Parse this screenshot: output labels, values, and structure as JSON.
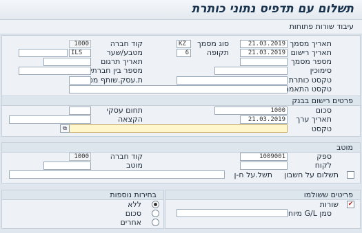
{
  "title": "תשלום עם תדפיס נתוני כותרת",
  "toolbar": {
    "open_items_label": "עיבוד שורות פתוחות"
  },
  "header_fields": {
    "doc_date": {
      "label": "תאריך מסמך",
      "value": "21.03.2019"
    },
    "doc_type": {
      "label": "סוג מסמך",
      "value": "KZ"
    },
    "company_code": {
      "label": "קוד חברה",
      "value": "1000"
    },
    "posting_date": {
      "label": "תאריך רישום",
      "value": "21.03.2019"
    },
    "period": {
      "label": "תקופה",
      "value": "6"
    },
    "currency_rate": {
      "label": "מטבע/שער",
      "value": "ILS"
    },
    "doc_number": {
      "label": "מספר מסמך",
      "value": ""
    },
    "translation_date": {
      "label": "תאריך תרגום",
      "value": ""
    },
    "reference": {
      "label": "סימוכין",
      "value": ""
    },
    "intercompany_number": {
      "label": "מספר בין חברתי",
      "value": ""
    },
    "header_text": {
      "label": "טקסט כותרת מסמך",
      "value": ""
    },
    "trading_partner": {
      "label": "ת.עסק.שותף מסחר",
      "value": ""
    },
    "clearing_text": {
      "label": "טקסט התאמה",
      "value": ""
    }
  },
  "bank_section": {
    "header": "פרטים רישום בבנק",
    "amount": {
      "label": "סכום",
      "value": "1000"
    },
    "business_area": {
      "label": "תחום עסקי",
      "value": ""
    },
    "value_date": {
      "label": "תאריך ערך",
      "value": "21.03.2019"
    },
    "assignment": {
      "label": "הקצאה",
      "value": ""
    },
    "text": {
      "label": "טקסט",
      "value": ""
    }
  },
  "payee_section": {
    "header": "מוטב",
    "vendor": {
      "label": "ספק",
      "value": "1009001"
    },
    "company_code": {
      "label": "קוד חברה",
      "value": "1000"
    },
    "customer": {
      "label": "לקוח",
      "value": ""
    },
    "payee": {
      "label": "מוטב",
      "value": ""
    },
    "pay_on_account_label": "תשלום על חשבון",
    "payment_on_behalf_label": "תשל.על ח-ן"
  },
  "paid_items_section": {
    "header": "פריטים ששולמו",
    "lines": {
      "label": "שורות",
      "checked": true
    },
    "special_gl": {
      "label": "סמן G/L מיוחד",
      "value": ""
    }
  },
  "additional_selections": {
    "header": "בחירות נוספות",
    "options": [
      {
        "label": "ללא",
        "selected": true
      },
      {
        "label": "סכום",
        "selected": false
      },
      {
        "label": "אחרים",
        "selected": false
      }
    ]
  },
  "colors": {
    "background": "#dfe6ee",
    "panel": "#eef2f6",
    "required_field": "#fff6cc",
    "title_text": "#17324d"
  }
}
